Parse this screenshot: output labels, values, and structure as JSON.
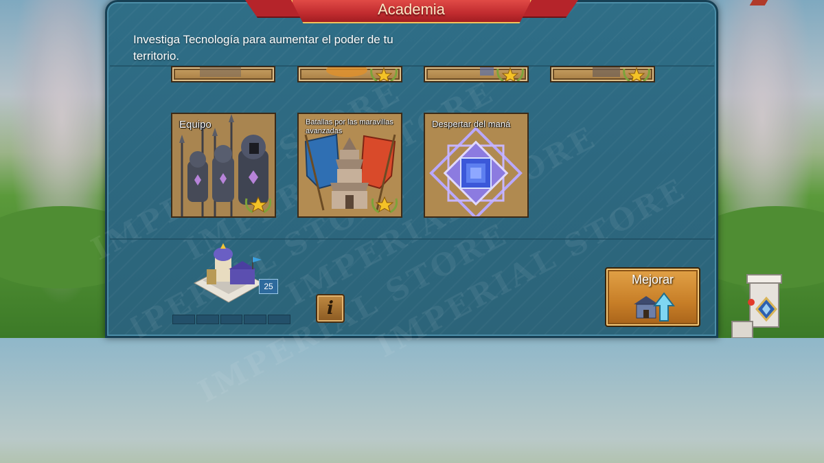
{
  "header": {
    "title": "Academia"
  },
  "description": "Investiga Tecnología para aumentar el poder de tu territorio.",
  "watermark": "IMPERIAL STORE",
  "tiles": [
    {
      "name": "Equipo",
      "stars": 1
    },
    {
      "name": "Batallas por las maravillas avanzadas",
      "stars": 1
    },
    {
      "name": "Despertar del maná",
      "stars": 0
    }
  ],
  "building": {
    "level": "25",
    "progress_segments": 5
  },
  "actions": {
    "info_label": "i",
    "upgrade_label": "Mejorar"
  },
  "colors": {
    "panel": "#2f6e87",
    "ribbon": "#c12c2f",
    "tile": "#b88c50",
    "star": "#f4c227"
  }
}
